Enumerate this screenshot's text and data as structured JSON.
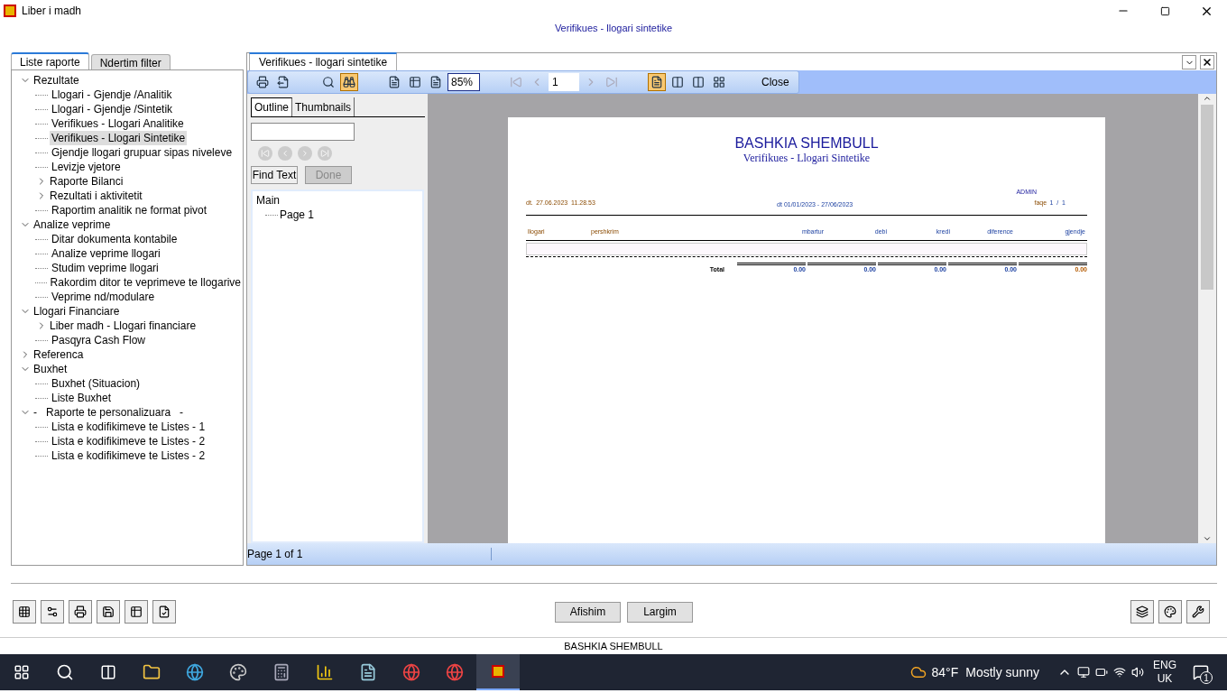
{
  "window": {
    "title": "Liber i madh",
    "subtitle": "Verifikues - llogari sintetike"
  },
  "left_tabs": [
    {
      "label": "Liste raporte",
      "selected": true
    },
    {
      "label": "Ndertim filter",
      "selected": false
    }
  ],
  "tree": [
    {
      "label": "Rezultate",
      "expanded": true,
      "selected": false,
      "children": [
        {
          "label": "Llogari - Gjendje /Analitik",
          "selected": false
        },
        {
          "label": "Llogari - Gjendje /Sintetik",
          "selected": false
        },
        {
          "label": "Verifikues - Llogari Analitike",
          "selected": false
        },
        {
          "label": "Verifikues - Llogari Sintetike",
          "selected": true
        },
        {
          "label": "Gjendje llogari grupuar sipas niveleve",
          "selected": false
        },
        {
          "label": "Levizje vjetore",
          "selected": false
        },
        {
          "label": "Raporte Bilanci",
          "expanded": false,
          "selected": false
        },
        {
          "label": "Rezultati i aktivitetit",
          "expanded": false,
          "selected": false
        },
        {
          "label": "Raportim analitik ne format pivot",
          "selected": false
        }
      ]
    },
    {
      "label": "Analize veprime",
      "expanded": true,
      "selected": false,
      "children": [
        {
          "label": "Ditar dokumenta kontabile",
          "selected": false
        },
        {
          "label": "Analize veprime llogari",
          "selected": false
        },
        {
          "label": "Studim veprime llogari",
          "selected": false
        },
        {
          "label": "Rakordim ditor te veprimeve te llogarive",
          "selected": false
        },
        {
          "label": "Veprime nd/modulare",
          "selected": false
        }
      ]
    },
    {
      "label": "Llogari Financiare",
      "expanded": true,
      "selected": false,
      "children": [
        {
          "label": "Liber madh - Llogari financiare",
          "expanded": false,
          "selected": false
        },
        {
          "label": "Pasqyra Cash Flow",
          "selected": false
        }
      ]
    },
    {
      "label": "Referenca",
      "expanded": false,
      "selected": false
    },
    {
      "label": "Buxhet",
      "expanded": true,
      "selected": false,
      "children": [
        {
          "label": "Buxhet (Situacion)",
          "selected": false
        },
        {
          "label": "Liste Buxhet",
          "selected": false
        }
      ]
    },
    {
      "label": "-   Raporte te personalizuara   -",
      "expanded": true,
      "selected": false,
      "children": [
        {
          "label": "Lista e kodifikimeve te Listes - 1",
          "selected": false
        },
        {
          "label": "Lista e kodifikimeve te Listes - 2",
          "selected": false
        },
        {
          "label": "Lista e kodifikimeve te Listes - 2",
          "selected": false
        }
      ]
    }
  ],
  "doc_tab": {
    "label": "Verifikues - llogari sintetike"
  },
  "toolbar": [
    {
      "kind": "print",
      "selected": false
    },
    {
      "kind": "export",
      "selected": false
    },
    {
      "kind": "gap"
    },
    {
      "kind": "zoom",
      "selected": false
    },
    {
      "kind": "find",
      "selected": true
    },
    {
      "kind": "gap"
    },
    {
      "kind": "page-setup",
      "selected": false
    },
    {
      "kind": "fit-width",
      "selected": false
    },
    {
      "kind": "fit-page",
      "selected": false
    },
    {
      "kind": "zoom-field",
      "value": "85%"
    },
    {
      "kind": "gap"
    },
    {
      "kind": "first",
      "disabled": true
    },
    {
      "kind": "prev",
      "disabled": true
    },
    {
      "kind": "page-field",
      "value": "1"
    },
    {
      "kind": "next",
      "disabled": true
    },
    {
      "kind": "last",
      "disabled": true
    },
    {
      "kind": "gap"
    },
    {
      "kind": "one-page",
      "selected": true
    },
    {
      "kind": "two-pages",
      "selected": false
    },
    {
      "kind": "book",
      "selected": false
    },
    {
      "kind": "four-pages",
      "selected": false
    },
    {
      "kind": "close",
      "label": "Close"
    }
  ],
  "side_tabs": [
    {
      "label": "Outline",
      "selected": true
    },
    {
      "label": "Thumbnails",
      "selected": false
    }
  ],
  "find": {
    "nav": [
      {
        "kind": "first",
        "disabled": true
      },
      {
        "kind": "prev",
        "disabled": true
      },
      {
        "kind": "next",
        "disabled": true
      },
      {
        "kind": "last",
        "disabled": true
      }
    ],
    "buttons": [
      {
        "label": "Find Text",
        "disabled": false
      },
      {
        "label": "Done",
        "disabled": true
      }
    ]
  },
  "outline": [
    {
      "label": "Main",
      "children": [
        {
          "label": "Page 1"
        }
      ]
    }
  ],
  "report": {
    "title": "BASHKIA SHEMBULL",
    "subtitle": "Verifikues - Llogari Sintetike",
    "user": "ADMIN",
    "date_label": "dt.",
    "date": "27.06.2023  11.28.53",
    "period": "dt 01/01/2023 - 27/06/2023",
    "page_label": "faqe",
    "page": "1  /  1",
    "columns": [
      "llogari",
      "pershkrim",
      "mbartur",
      "debi",
      "kredi",
      "diference",
      "gjendje"
    ],
    "total_label": "Total",
    "totals": [
      "0.00",
      "0.00",
      "0.00",
      "0.00",
      "0.00"
    ]
  },
  "status": {
    "page": "Page 1 of 1"
  },
  "bottom_buttons": [
    {
      "label": "Afishim"
    },
    {
      "label": "Largim"
    }
  ],
  "status_bar": "BASHKIA SHEMBULL",
  "taskbar": {
    "temperature": "84°F",
    "weather": "Mostly sunny",
    "language": "ENG",
    "region": "UK",
    "notifications": "1"
  }
}
